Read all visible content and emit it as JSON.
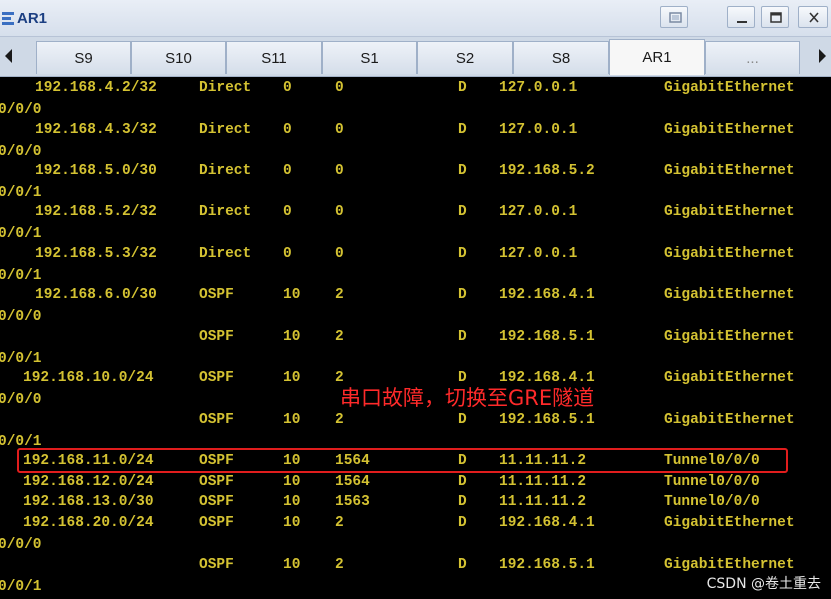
{
  "window": {
    "title": "AR1"
  },
  "tabs": [
    {
      "label": "S9"
    },
    {
      "label": "S10"
    },
    {
      "label": "S11"
    },
    {
      "label": "S1"
    },
    {
      "label": "S2"
    },
    {
      "label": "S8"
    },
    {
      "label": "AR1",
      "active": true
    },
    {
      "label": "..."
    }
  ],
  "routes": [
    {
      "dest": "192.168.4.2/32",
      "proto": "Direct",
      "pre": "0",
      "cost": "0",
      "flags": "D",
      "nexthop": "127.0.0.1",
      "iface": "GigabitEthernet",
      "wrap": "0/0/0"
    },
    {
      "dest": "192.168.4.3/32",
      "proto": "Direct",
      "pre": "0",
      "cost": "0",
      "flags": "D",
      "nexthop": "127.0.0.1",
      "iface": "GigabitEthernet",
      "wrap": "0/0/0"
    },
    {
      "dest": "192.168.5.0/30",
      "proto": "Direct",
      "pre": "0",
      "cost": "0",
      "flags": "D",
      "nexthop": "192.168.5.2",
      "iface": "GigabitEthernet",
      "wrap": "0/0/1"
    },
    {
      "dest": "192.168.5.2/32",
      "proto": "Direct",
      "pre": "0",
      "cost": "0",
      "flags": "D",
      "nexthop": "127.0.0.1",
      "iface": "GigabitEthernet",
      "wrap": "0/0/1"
    },
    {
      "dest": "192.168.5.3/32",
      "proto": "Direct",
      "pre": "0",
      "cost": "0",
      "flags": "D",
      "nexthop": "127.0.0.1",
      "iface": "GigabitEthernet",
      "wrap": "0/0/1"
    },
    {
      "dest": "192.168.6.0/30",
      "proto": "OSPF",
      "pre": "10",
      "cost": "2",
      "flags": "D",
      "nexthop": "192.168.4.1",
      "iface": "GigabitEthernet",
      "wrap": "0/0/0"
    },
    {
      "dest": "",
      "proto": "OSPF",
      "pre": "10",
      "cost": "2",
      "flags": "D",
      "nexthop": "192.168.5.1",
      "iface": "GigabitEthernet",
      "wrap": "0/0/1"
    },
    {
      "dest": "192.168.10.0/24",
      "proto": "OSPF",
      "pre": "10",
      "cost": "2",
      "flags": "D",
      "nexthop": "192.168.4.1",
      "iface": "GigabitEthernet",
      "wrap": "0/0/0"
    },
    {
      "dest": "",
      "proto": "OSPF",
      "pre": "10",
      "cost": "2",
      "flags": "D",
      "nexthop": "192.168.5.1",
      "iface": "GigabitEthernet",
      "wrap": "0/0/1"
    },
    {
      "dest": "192.168.11.0/24",
      "proto": "OSPF",
      "pre": "10",
      "cost": "1564",
      "flags": "D",
      "nexthop": "11.11.11.2",
      "iface": "Tunnel0/0/0",
      "wrap": ""
    },
    {
      "dest": "192.168.12.0/24",
      "proto": "OSPF",
      "pre": "10",
      "cost": "1564",
      "flags": "D",
      "nexthop": "11.11.11.2",
      "iface": "Tunnel0/0/0",
      "wrap": ""
    },
    {
      "dest": "192.168.13.0/30",
      "proto": "OSPF",
      "pre": "10",
      "cost": "1563",
      "flags": "D",
      "nexthop": "11.11.11.2",
      "iface": "Tunnel0/0/0",
      "wrap": ""
    },
    {
      "dest": "192.168.20.0/24",
      "proto": "OSPF",
      "pre": "10",
      "cost": "2",
      "flags": "D",
      "nexthop": "192.168.4.1",
      "iface": "GigabitEthernet",
      "wrap": "0/0/0"
    },
    {
      "dest": "",
      "proto": "OSPF",
      "pre": "10",
      "cost": "2",
      "flags": "D",
      "nexthop": "192.168.5.1",
      "iface": "GigabitEthernet",
      "wrap": "0/0/1"
    }
  ],
  "annotation": "串口故障，切换至GRE隧道",
  "watermark": "CSDN @卷土重去",
  "colors": {
    "terminal_text": "#d4c232",
    "terminal_bg": "#000000",
    "highlight": "#e11d1d",
    "annotation": "#ff2a2a"
  }
}
